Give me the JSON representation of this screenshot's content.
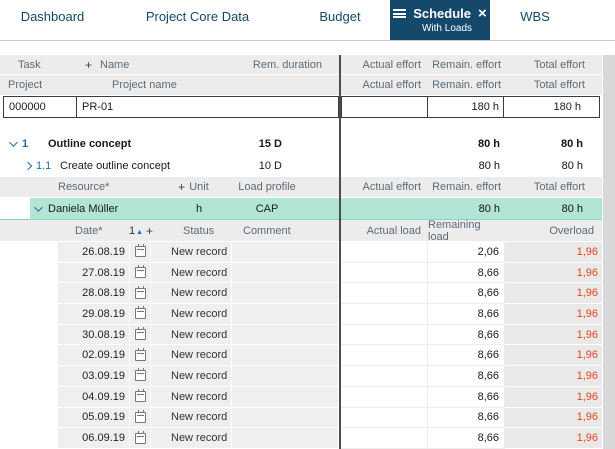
{
  "colors": {
    "active_tab_bg": "#15496b",
    "tab_text": "#15496b",
    "highlight_row_bg": "#b2e5d5",
    "accent_blue": "#1f6cab",
    "overload_red": "#e2451f"
  },
  "icons": {
    "close": "×",
    "sort_asc": "▲"
  },
  "tabs": [
    {
      "label": "Dashboard"
    },
    {
      "label": "Project Core Data"
    },
    {
      "label": "Budget"
    },
    {
      "label": "Schedule",
      "sublabel": "With Loads"
    },
    {
      "label": "WBS"
    }
  ],
  "table": {
    "header1": {
      "task": "Task",
      "plus": "+",
      "name": "Name",
      "rem_duration": "Rem. duration",
      "actual_effort": "Actual effort",
      "remain_effort": "Remain. effort",
      "total_effort": "Total effort"
    },
    "header2": {
      "project": "Project",
      "project_name": "Project name",
      "actual_effort": "Actual effort",
      "remain_effort": "Remain. effort",
      "total_effort": "Total effort"
    },
    "project_row": {
      "id": "000000",
      "name": "PR-01",
      "actual_effort": "",
      "remain_effort": "180 h",
      "total_effort": "180 h"
    },
    "tasks": [
      {
        "number": "1",
        "name": "Outline concept",
        "rem_duration": "15 D",
        "actual_effort": "",
        "remain_effort": "80 h",
        "total_effort": "80 h"
      },
      {
        "number": "1.1",
        "name": "Create outline concept",
        "rem_duration": "10 D",
        "actual_effort": "",
        "remain_effort": "80 h",
        "total_effort": "80 h"
      }
    ],
    "resource_header": {
      "resource": "Resource*",
      "plus": "+",
      "unit": "Unit",
      "load_profile": "Load profile",
      "actual_effort": "Actual effort",
      "remain_effort": "Remain. effort",
      "total_effort": "Total effort"
    },
    "resource_row": {
      "name": "Daniela Müller",
      "unit": "h",
      "load_profile": "CAP",
      "actual_effort": "",
      "remain_effort": "80 h",
      "total_effort": "80 h"
    },
    "load_header": {
      "date": "Date*",
      "sort_number": "1",
      "plus": "+",
      "status": "Status",
      "comment": "Comment",
      "actual_load": "Actual load",
      "remaining_load": "Remaining load",
      "overload": "Overload"
    },
    "load_rows": [
      {
        "date": "26.08.19",
        "status": "New record",
        "comment": "",
        "actual_load": "",
        "remaining_load": "2,06",
        "overload": "1,96"
      },
      {
        "date": "27.08.19",
        "status": "New record",
        "comment": "",
        "actual_load": "",
        "remaining_load": "8,66",
        "overload": "1,96"
      },
      {
        "date": "28.08.19",
        "status": "New record",
        "comment": "",
        "actual_load": "",
        "remaining_load": "8,66",
        "overload": "1,96"
      },
      {
        "date": "29.08.19",
        "status": "New record",
        "comment": "",
        "actual_load": "",
        "remaining_load": "8,66",
        "overload": "1,96"
      },
      {
        "date": "30.08.19",
        "status": "New record",
        "comment": "",
        "actual_load": "",
        "remaining_load": "8,66",
        "overload": "1,96"
      },
      {
        "date": "02.09.19",
        "status": "New record",
        "comment": "",
        "actual_load": "",
        "remaining_load": "8,66",
        "overload": "1,96"
      },
      {
        "date": "03.09.19",
        "status": "New record",
        "comment": "",
        "actual_load": "",
        "remaining_load": "8,66",
        "overload": "1,96"
      },
      {
        "date": "04.09.19",
        "status": "New record",
        "comment": "",
        "actual_load": "",
        "remaining_load": "8,66",
        "overload": "1,96"
      },
      {
        "date": "05.09.19",
        "status": "New record",
        "comment": "",
        "actual_load": "",
        "remaining_load": "8,66",
        "overload": "1,96"
      },
      {
        "date": "06.09.19",
        "status": "New record",
        "comment": "",
        "actual_load": "",
        "remaining_load": "8,66",
        "overload": "1,96"
      }
    ]
  }
}
